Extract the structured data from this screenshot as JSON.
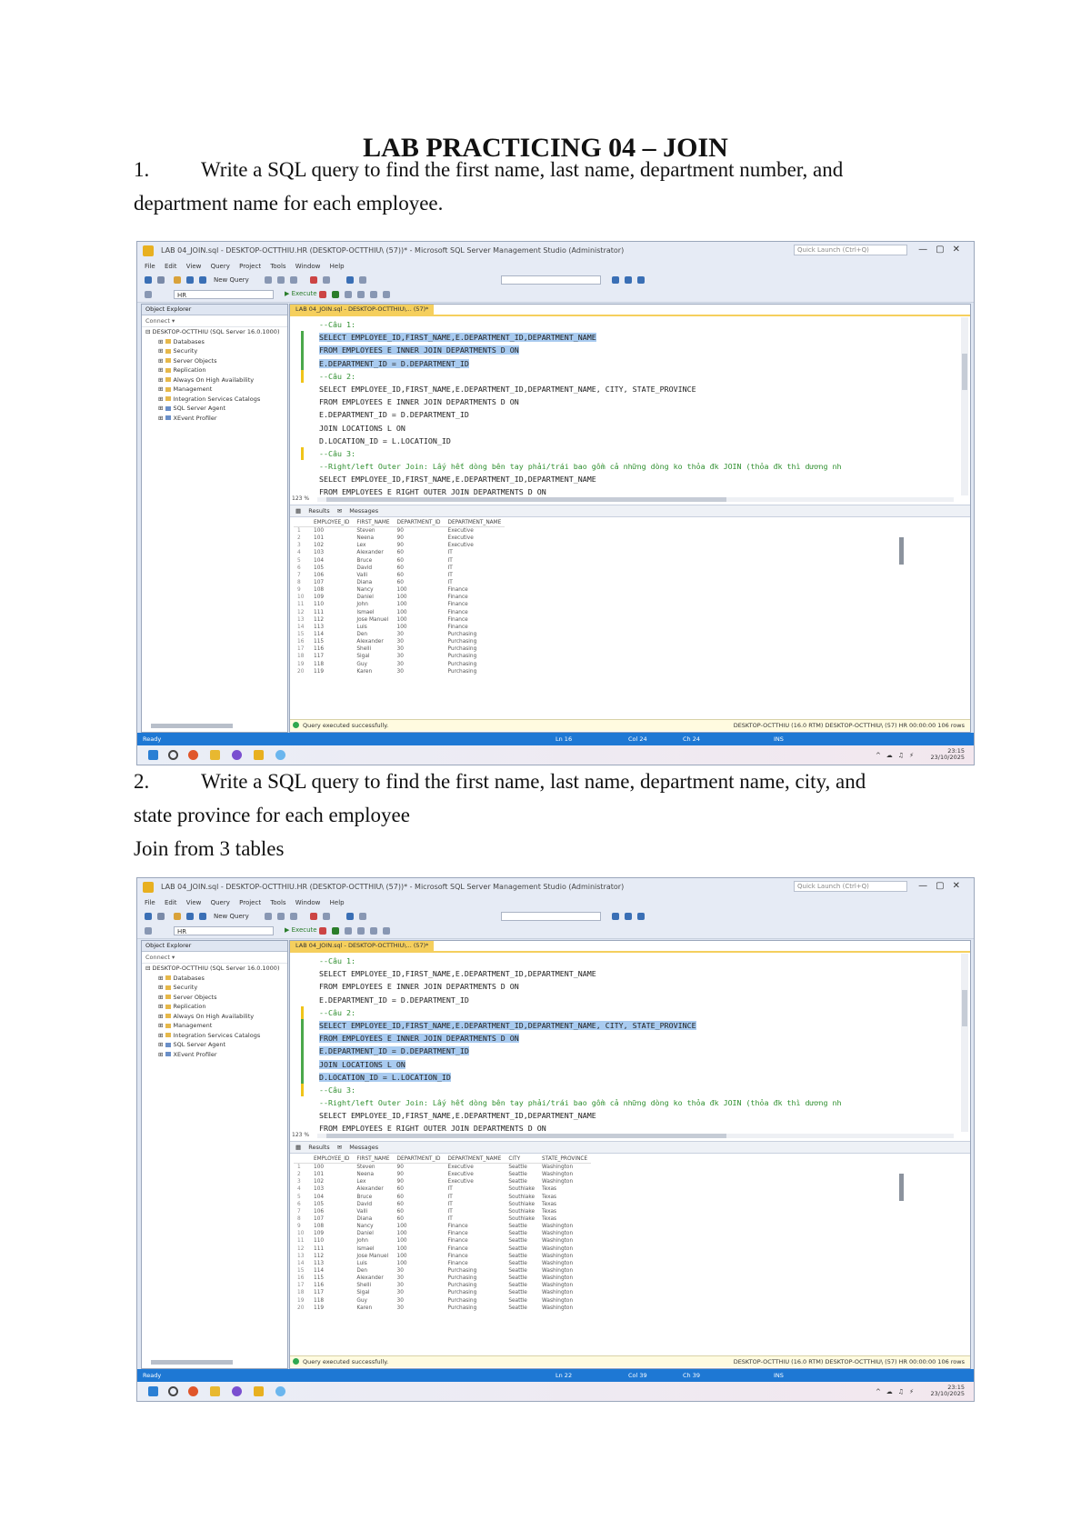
{
  "doc": {
    "title": "LAB PRACTICING 04 – JOIN",
    "q1_num": "1.",
    "q1_line1": "Write a SQL query to find the first name, last name, department number, and",
    "q1_line2": "department name for each employee.",
    "q2_num": "2.",
    "q2_line1": "Write a SQL query to find the first name, last name, department name, city, and",
    "q2_line2": "state province for each employee",
    "q2_note": "Join from 3 tables"
  },
  "shot1": {
    "tab": "LAB 04_JOIN.sql - DESKTOP-OCTTHIU\\... (57)*",
    "code": [
      {
        "t": "--Câu 1:",
        "c": "cm",
        "hl": false,
        "g": ""
      },
      {
        "t": "SELECT EMPLOYEE_ID,FIRST_NAME,E.DEPARTMENT_ID,DEPARTMENT_NAME",
        "c": "",
        "hl": true,
        "g": "sel"
      },
      {
        "t": "FROM EMPLOYEES E INNER JOIN DEPARTMENTS D ON",
        "c": "",
        "hl": true,
        "g": "sel"
      },
      {
        "t": "E.DEPARTMENT_ID = D.DEPARTMENT_ID",
        "c": "",
        "hl": true,
        "g": "sel"
      },
      {
        "t": "--Câu 2:",
        "c": "cm",
        "hl": false,
        "g": "mark"
      },
      {
        "t": "SELECT EMPLOYEE_ID,FIRST_NAME,E.DEPARTMENT_ID,DEPARTMENT_NAME, CITY, STATE_PROVINCE",
        "c": "",
        "hl": false,
        "g": ""
      },
      {
        "t": "FROM EMPLOYEES E INNER JOIN DEPARTMENTS D ON",
        "c": "",
        "hl": false,
        "g": ""
      },
      {
        "t": "E.DEPARTMENT_ID = D.DEPARTMENT_ID",
        "c": "",
        "hl": false,
        "g": ""
      },
      {
        "t": "JOIN LOCATIONS L ON",
        "c": "",
        "hl": false,
        "g": ""
      },
      {
        "t": "D.LOCATION_ID = L.LOCATION_ID",
        "c": "",
        "hl": false,
        "g": ""
      },
      {
        "t": "--Câu 3:",
        "c": "cm",
        "hl": false,
        "g": "mark"
      },
      {
        "t": "--Right/left Outer Join: Lấy hết dòng bên tay phải/trái bao gồm cả những dòng ko thỏa đk JOIN (thỏa đk thì dương nh",
        "c": "cm",
        "hl": false,
        "g": ""
      },
      {
        "t": "SELECT EMPLOYEE_ID,FIRST_NAME,E.DEPARTMENT_ID,DEPARTMENT_NAME",
        "c": "",
        "hl": false,
        "g": ""
      },
      {
        "t": "FROM EMPLOYEES E RIGHT OUTER JOIN DEPARTMENTS D ON",
        "c": "",
        "hl": false,
        "g": ""
      }
    ],
    "columns": [
      "EMPLOYEE_ID",
      "FIRST_NAME",
      "DEPARTMENT_ID",
      "DEPARTMENT_NAME"
    ],
    "rows": [
      [
        "100",
        "Steven",
        "90",
        "Executive"
      ],
      [
        "101",
        "Neena",
        "90",
        "Executive"
      ],
      [
        "102",
        "Lex",
        "90",
        "Executive"
      ],
      [
        "103",
        "Alexander",
        "60",
        "IT"
      ],
      [
        "104",
        "Bruce",
        "60",
        "IT"
      ],
      [
        "105",
        "David",
        "60",
        "IT"
      ],
      [
        "106",
        "Valli",
        "60",
        "IT"
      ],
      [
        "107",
        "Diana",
        "60",
        "IT"
      ],
      [
        "108",
        "Nancy",
        "100",
        "Finance"
      ],
      [
        "109",
        "Daniel",
        "100",
        "Finance"
      ],
      [
        "110",
        "John",
        "100",
        "Finance"
      ],
      [
        "111",
        "Ismael",
        "100",
        "Finance"
      ],
      [
        "112",
        "Jose Manuel",
        "100",
        "Finance"
      ],
      [
        "113",
        "Luis",
        "100",
        "Finance"
      ],
      [
        "114",
        "Den",
        "30",
        "Purchasing"
      ],
      [
        "115",
        "Alexander",
        "30",
        "Purchasing"
      ],
      [
        "116",
        "Shelli",
        "30",
        "Purchasing"
      ],
      [
        "117",
        "Sigal",
        "30",
        "Purchasing"
      ],
      [
        "118",
        "Guy",
        "30",
        "Purchasing"
      ],
      [
        "119",
        "Karen",
        "30",
        "Purchasing"
      ]
    ],
    "status_left": "Query executed successfully.",
    "status_right": "DESKTOP-OCTTHIU (16.0 RTM)   DESKTOP-OCTTHIU\\ (57)   HR   00:00:00   106 rows",
    "bar": {
      "ready": "Ready",
      "ln": "Ln 16",
      "col": "Col 24",
      "ch": "Ch 24",
      "ins": "INS"
    },
    "time": "23:15",
    "date": "23/10/2025"
  },
  "shot2": {
    "tab": "LAB 04_JOIN.sql - DESKTOP-OCTTHIU\\... (57)*",
    "code": [
      {
        "t": "--Câu 1:",
        "c": "cm",
        "hl": false,
        "g": ""
      },
      {
        "t": "SELECT EMPLOYEE_ID,FIRST_NAME,E.DEPARTMENT_ID,DEPARTMENT_NAME",
        "c": "",
        "hl": false,
        "g": ""
      },
      {
        "t": "FROM EMPLOYEES E INNER JOIN DEPARTMENTS D ON",
        "c": "",
        "hl": false,
        "g": ""
      },
      {
        "t": "E.DEPARTMENT_ID = D.DEPARTMENT_ID",
        "c": "",
        "hl": false,
        "g": ""
      },
      {
        "t": "--Câu 2:",
        "c": "cm",
        "hl": false,
        "g": "mark"
      },
      {
        "t": "SELECT EMPLOYEE_ID,FIRST_NAME,E.DEPARTMENT_ID,DEPARTMENT_NAME, CITY, STATE_PROVINCE",
        "c": "",
        "hl": true,
        "g": "sel"
      },
      {
        "t": "FROM EMPLOYEES E INNER JOIN DEPARTMENTS D ON",
        "c": "",
        "hl": true,
        "g": "sel"
      },
      {
        "t": "E.DEPARTMENT_ID = D.DEPARTMENT_ID",
        "c": "",
        "hl": true,
        "g": "sel"
      },
      {
        "t": "JOIN LOCATIONS L ON",
        "c": "",
        "hl": true,
        "g": "sel"
      },
      {
        "t": "D.LOCATION_ID = L.LOCATION_ID",
        "c": "",
        "hl": true,
        "g": "sel"
      },
      {
        "t": "--Câu 3:",
        "c": "cm",
        "hl": false,
        "g": "mark"
      },
      {
        "t": "--Right/left Outer Join: Lấy hết dòng bên tay phải/trái bao gồm cả những dòng ko thỏa đk JOIN (thỏa đk thì dương nh",
        "c": "cm",
        "hl": false,
        "g": ""
      },
      {
        "t": "SELECT EMPLOYEE_ID,FIRST_NAME,E.DEPARTMENT_ID,DEPARTMENT_NAME",
        "c": "",
        "hl": false,
        "g": ""
      },
      {
        "t": "FROM EMPLOYEES E RIGHT OUTER JOIN DEPARTMENTS D ON",
        "c": "",
        "hl": false,
        "g": ""
      }
    ],
    "columns": [
      "EMPLOYEE_ID",
      "FIRST_NAME",
      "DEPARTMENT_ID",
      "DEPARTMENT_NAME",
      "CITY",
      "STATE_PROVINCE"
    ],
    "rows": [
      [
        "100",
        "Steven",
        "90",
        "Executive",
        "Seattle",
        "Washington"
      ],
      [
        "101",
        "Neena",
        "90",
        "Executive",
        "Seattle",
        "Washington"
      ],
      [
        "102",
        "Lex",
        "90",
        "Executive",
        "Seattle",
        "Washington"
      ],
      [
        "103",
        "Alexander",
        "60",
        "IT",
        "Southlake",
        "Texas"
      ],
      [
        "104",
        "Bruce",
        "60",
        "IT",
        "Southlake",
        "Texas"
      ],
      [
        "105",
        "David",
        "60",
        "IT",
        "Southlake",
        "Texas"
      ],
      [
        "106",
        "Valli",
        "60",
        "IT",
        "Southlake",
        "Texas"
      ],
      [
        "107",
        "Diana",
        "60",
        "IT",
        "Southlake",
        "Texas"
      ],
      [
        "108",
        "Nancy",
        "100",
        "Finance",
        "Seattle",
        "Washington"
      ],
      [
        "109",
        "Daniel",
        "100",
        "Finance",
        "Seattle",
        "Washington"
      ],
      [
        "110",
        "John",
        "100",
        "Finance",
        "Seattle",
        "Washington"
      ],
      [
        "111",
        "Ismael",
        "100",
        "Finance",
        "Seattle",
        "Washington"
      ],
      [
        "112",
        "Jose Manuel",
        "100",
        "Finance",
        "Seattle",
        "Washington"
      ],
      [
        "113",
        "Luis",
        "100",
        "Finance",
        "Seattle",
        "Washington"
      ],
      [
        "114",
        "Den",
        "30",
        "Purchasing",
        "Seattle",
        "Washington"
      ],
      [
        "115",
        "Alexander",
        "30",
        "Purchasing",
        "Seattle",
        "Washington"
      ],
      [
        "116",
        "Shelli",
        "30",
        "Purchasing",
        "Seattle",
        "Washington"
      ],
      [
        "117",
        "Sigal",
        "30",
        "Purchasing",
        "Seattle",
        "Washington"
      ],
      [
        "118",
        "Guy",
        "30",
        "Purchasing",
        "Seattle",
        "Washington"
      ],
      [
        "119",
        "Karen",
        "30",
        "Purchasing",
        "Seattle",
        "Washington"
      ]
    ],
    "status_left": "Query executed successfully.",
    "status_right": "DESKTOP-OCTTHIU (16.0 RTM)   DESKTOP-OCTTHIU\\ (57)   HR   00:00:00   106 rows",
    "bar": {
      "ready": "Ready",
      "ln": "Ln 22",
      "col": "Col 39",
      "ch": "Ch 39",
      "ins": "INS"
    },
    "time": "23:15",
    "date": "23/10/2025"
  },
  "common": {
    "window_title": "LAB 04_JOIN.sql - DESKTOP-OCTTHIU.HR (DESKTOP-OCTTHIU\\ (57))* - Microsoft SQL Server Management Studio (Administrator)",
    "quick_launch": "Quick Launch (Ctrl+Q)",
    "menu": [
      "File",
      "Edit",
      "View",
      "Query",
      "Project",
      "Tools",
      "Window",
      "Help"
    ],
    "new_query": "New Query",
    "db_name": "HR",
    "execute": "▶ Execute",
    "oe_title": "Object Explorer",
    "oe_connect": "Connect ▾",
    "oe_server": "DESKTOP-OCTTHIU (SQL Server 16.0.1000)",
    "oe_nodes": [
      "Databases",
      "Security",
      "Server Objects",
      "Replication",
      "Always On High Availability",
      "Management",
      "Integration Services Catalogs"
    ],
    "oe_children": [
      "SQL Server Agent",
      "XEvent Profiler"
    ],
    "zoom": "123 %",
    "results_tab": "Results",
    "messages_tab": "Messages"
  }
}
